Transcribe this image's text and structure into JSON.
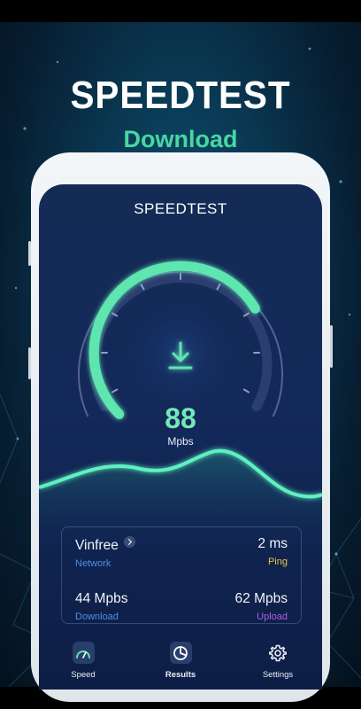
{
  "promo": {
    "title": "SPEEDTEST",
    "subtitle": "Download"
  },
  "app": {
    "title": "SPEEDTEST"
  },
  "gauge": {
    "value": "88",
    "unit": "Mpbs",
    "progress_fraction": 0.72,
    "accent": "#5ee6b0",
    "icon": "download-icon"
  },
  "stats": {
    "network": {
      "value": "Vinfree",
      "label": "Network",
      "label_color": "#4e8fe0"
    },
    "ping": {
      "value": "2 ms",
      "label": "Ping",
      "label_color": "#f2c14b"
    },
    "download": {
      "value": "44 Mpbs",
      "label": "Download",
      "label_color": "#4e8fe0"
    },
    "upload": {
      "value": "62 Mpbs",
      "label": "Upload",
      "label_color": "#b45ae8"
    }
  },
  "tabs": [
    {
      "label": "Speed",
      "icon": "speedometer-icon",
      "active": false
    },
    {
      "label": "Results",
      "icon": "pie-chart-icon",
      "active": true
    },
    {
      "label": "Settings",
      "icon": "gear-icon",
      "active": false
    }
  ]
}
